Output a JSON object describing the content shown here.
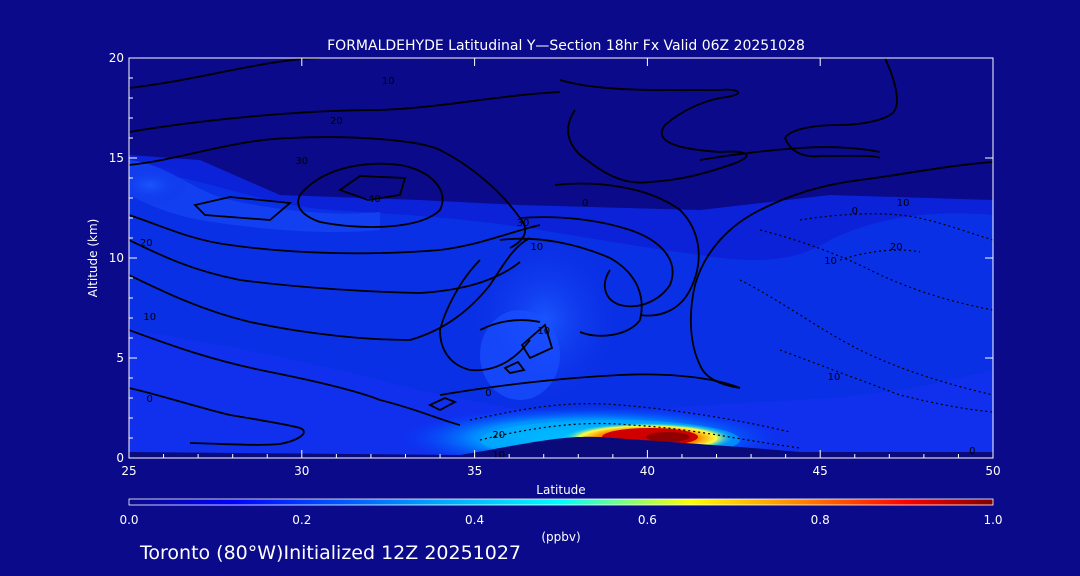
{
  "chart_data": {
    "type": "heatmap",
    "title": "FORMALDEHYDE Latitudinal Y—Section 18hr  Fx Valid 06Z 20251028",
    "xlabel": "Latitude",
    "ylabel": "Altitude (km)",
    "xlim": [
      25,
      50
    ],
    "ylim": [
      0,
      20
    ],
    "x_ticks": [
      "25",
      "30",
      "35",
      "40",
      "45",
      "50"
    ],
    "y_ticks": [
      "0",
      "5",
      "10",
      "15",
      "20"
    ],
    "colorbar": {
      "label": "(ppbv)",
      "range": [
        0.0,
        1.0
      ],
      "ticks": [
        "0.0",
        "0.2",
        "0.4",
        "0.6",
        "0.8",
        "1.0"
      ],
      "colormap": [
        "#0a0a8a",
        "#0000ff",
        "#00a0ff",
        "#00ffff",
        "#ffff00",
        "#ff8000",
        "#ff0000",
        "#800000"
      ]
    },
    "concentration_features": [
      {
        "label": "surface maximum",
        "lat": 40.5,
        "alt_km": 0.8,
        "value": 1.0
      },
      {
        "label": "upper tongue",
        "lat": 37,
        "alt_km": 8,
        "value": 0.15
      },
      {
        "label": "stratospheric band",
        "lat": 28,
        "alt_km": 12.5,
        "value": 0.1
      }
    ],
    "contour_labels": [
      {
        "text": "10",
        "lat": 32.5,
        "alt_km": 18.9
      },
      {
        "text": "20",
        "lat": 31.0,
        "alt_km": 16.9
      },
      {
        "text": "30",
        "lat": 30.0,
        "alt_km": 14.9
      },
      {
        "text": "40",
        "lat": 32.1,
        "alt_km": 13.0
      },
      {
        "text": "20",
        "lat": 25.5,
        "alt_km": 10.8
      },
      {
        "text": "10",
        "lat": 25.6,
        "alt_km": 7.1
      },
      {
        "text": "0",
        "lat": 25.6,
        "alt_km": 3.0
      },
      {
        "text": "30",
        "lat": 36.4,
        "alt_km": 11.8
      },
      {
        "text": "10",
        "lat": 36.8,
        "alt_km": 10.6
      },
      {
        "text": "10",
        "lat": 37.0,
        "alt_km": 6.4
      },
      {
        "text": "0",
        "lat": 38.2,
        "alt_km": 12.8
      },
      {
        "text": "0",
        "lat": 46.0,
        "alt_km": 12.4
      },
      {
        "text": "10",
        "lat": 47.4,
        "alt_km": 12.8
      },
      {
        "text": "20",
        "lat": 47.2,
        "alt_km": 10.6
      },
      {
        "text": "10",
        "lat": 45.3,
        "alt_km": 9.9
      },
      {
        "text": "10",
        "lat": 45.4,
        "alt_km": 4.1
      },
      {
        "text": "0",
        "lat": 35.4,
        "alt_km": 3.3
      },
      {
        "text": "20",
        "lat": 35.7,
        "alt_km": 1.2
      },
      {
        "text": "10",
        "lat": 35.7,
        "alt_km": 0.2
      },
      {
        "text": "0",
        "lat": 49.4,
        "alt_km": 0.4
      }
    ]
  },
  "footer": {
    "location_text": "Toronto (80°W)Initialized 12Z 20251027"
  }
}
